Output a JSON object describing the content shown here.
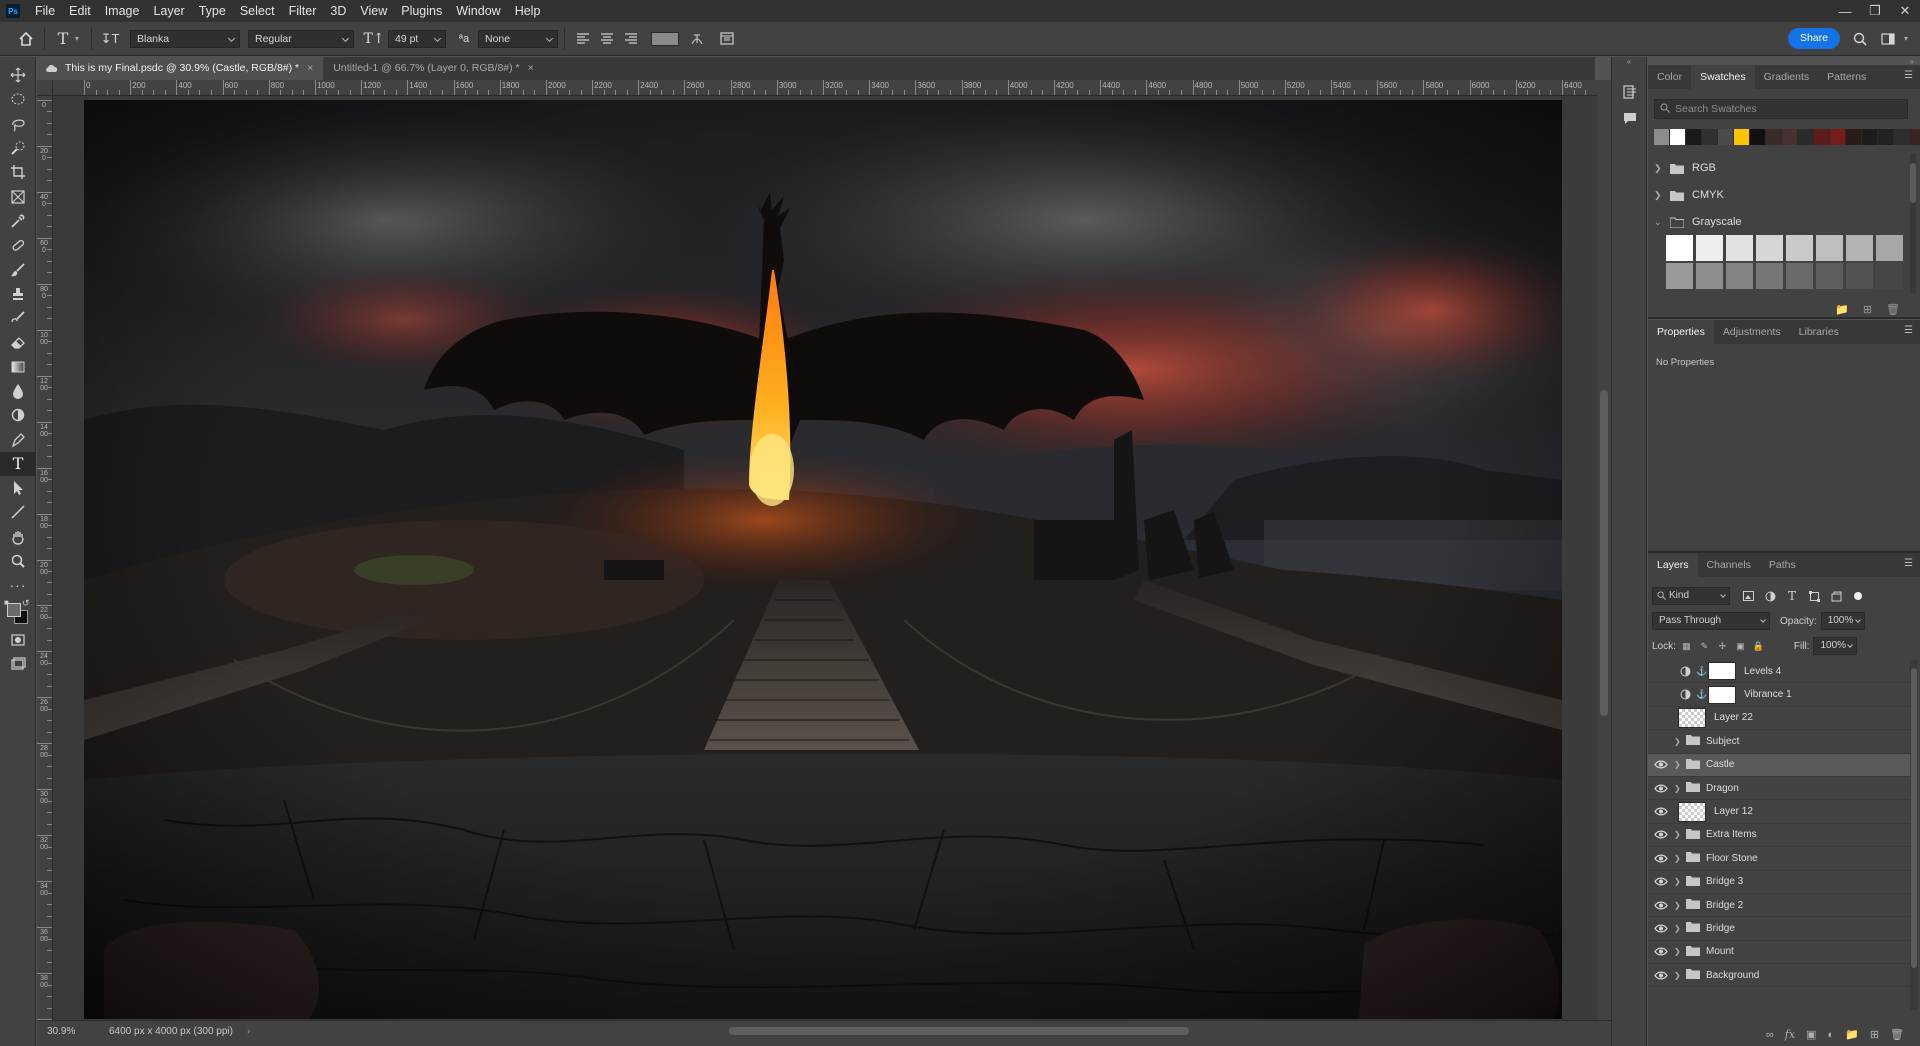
{
  "app": {
    "logo": "Ps"
  },
  "menu": [
    "File",
    "Edit",
    "Image",
    "Layer",
    "Type",
    "Select",
    "Filter",
    "3D",
    "View",
    "Plugins",
    "Window",
    "Help"
  ],
  "options": {
    "font_family": "Blanka",
    "font_style": "Regular",
    "font_size": "49 pt",
    "aa_label": "ªa",
    "anti_alias": "None",
    "share_label": "Share"
  },
  "tabs": [
    {
      "label": "This is my Final.psdc @ 30.9% (Castle, RGB/8#) *",
      "close": "×"
    },
    {
      "label": "Untitled-1 @ 66.7% (Layer 0, RGB/8#) *",
      "close": "×"
    }
  ],
  "ruler_h": [
    "0",
    "200",
    "400",
    "600",
    "800",
    "1000",
    "1200",
    "1400",
    "1600",
    "1800",
    "2000",
    "2200",
    "2400",
    "2600",
    "2800",
    "3000",
    "3200",
    "3400",
    "3600",
    "3800",
    "4000",
    "4200",
    "4400",
    "4600",
    "4800",
    "5000",
    "5200",
    "5400",
    "5600",
    "5800",
    "6000",
    "6200",
    "6400"
  ],
  "ruler_v": [
    "0",
    "200",
    "400",
    "600",
    "800",
    "1000",
    "1200",
    "1400",
    "1600",
    "1800",
    "2000",
    "2200",
    "2400",
    "2600",
    "2800",
    "3000",
    "3200",
    "3400",
    "3600",
    "3800",
    "4000"
  ],
  "status": {
    "zoom": "30.9%",
    "dimensions": "6400 px x 4000 px (300 ppi)",
    "arrow": "›"
  },
  "swatches_panel": {
    "tabs": [
      "Color",
      "Swatches",
      "Gradients",
      "Patterns"
    ],
    "active_tab": "Swatches",
    "search_placeholder": "Search Swatches",
    "recent": [
      "#8c8c8c",
      "#ffffff",
      "#1a1a1a",
      "#303030",
      "#4a4a4a",
      "#ffc400",
      "#111111",
      "#3a2b2b",
      "#4a3030",
      "#2b2b2b",
      "#5c1c1c",
      "#751d1d",
      "#2b1a1a",
      "#1c1c1c",
      "#222222",
      "#2e2e2e",
      "#3c2424"
    ],
    "groups": [
      "RGB",
      "CMYK",
      "Grayscale"
    ],
    "grayscale": [
      "#ffffff",
      "#eeeeee",
      "#e2e2e2",
      "#d6d6d6",
      "#cacaca",
      "#bebebe",
      "#b3b3b3",
      "#a7a7a7",
      "#9a9a9a",
      "#8e8e8e",
      "#828282",
      "#767676",
      "#6a6a6a",
      "#5e5e5e",
      "#535353",
      "#474747"
    ]
  },
  "properties_panel": {
    "tabs": [
      "Properties",
      "Adjustments",
      "Libraries"
    ],
    "active_tab": "Properties",
    "content": "No Properties"
  },
  "layers_panel": {
    "tabs": [
      "Layers",
      "Channels",
      "Paths"
    ],
    "active_tab": "Layers",
    "filter_kind": "Kind",
    "blend_mode": "Pass Through",
    "opacity_label": "Opacity:",
    "opacity": "100%",
    "lock_label": "Lock:",
    "fill_label": "Fill:",
    "fill": "100%",
    "layers": [
      {
        "name": "Levels 4",
        "type": "adjustment",
        "visible": false,
        "selected": false
      },
      {
        "name": "Vibrance 1",
        "type": "adjustment",
        "visible": false,
        "selected": false
      },
      {
        "name": "Layer 22",
        "type": "pixel",
        "visible": false,
        "selected": false
      },
      {
        "name": "Subject",
        "type": "group",
        "visible": false,
        "selected": false
      },
      {
        "name": "Castle",
        "type": "group",
        "visible": true,
        "selected": true
      },
      {
        "name": "Dragon",
        "type": "group",
        "visible": true,
        "selected": false
      },
      {
        "name": "Layer 12",
        "type": "pixel",
        "visible": true,
        "selected": false
      },
      {
        "name": "Extra Items",
        "type": "group",
        "visible": true,
        "selected": false
      },
      {
        "name": "Floor Stone",
        "type": "group",
        "visible": true,
        "selected": false
      },
      {
        "name": "Bridge 3",
        "type": "group",
        "visible": true,
        "selected": false
      },
      {
        "name": "Bridge 2",
        "type": "group",
        "visible": true,
        "selected": false
      },
      {
        "name": "Bridge",
        "type": "group",
        "visible": true,
        "selected": false
      },
      {
        "name": "Mount",
        "type": "group",
        "visible": true,
        "selected": false
      },
      {
        "name": "Background",
        "type": "group",
        "visible": true,
        "selected": false
      }
    ]
  },
  "tools": [
    "move-tool-icon",
    "marquee-tool-icon",
    "lasso-tool-icon",
    "quick-select-tool-icon",
    "crop-tool-icon",
    "frame-tool-icon",
    "eyedropper-tool-icon",
    "healing-brush-tool-icon",
    "brush-tool-icon",
    "clone-stamp-tool-icon",
    "history-brush-tool-icon",
    "eraser-tool-icon",
    "gradient-tool-icon",
    "blur-tool-icon",
    "dodge-tool-icon",
    "pen-tool-icon",
    "type-tool-icon",
    "path-select-tool-icon",
    "line-tool-icon",
    "hand-tool-icon",
    "zoom-tool-icon",
    "more-tools-icon"
  ],
  "colors": {
    "accent": "#1473e6",
    "panel_bg": "#424242",
    "canvas_bg": "#3b3b3b",
    "selected_layer": "#5a5a5a"
  }
}
